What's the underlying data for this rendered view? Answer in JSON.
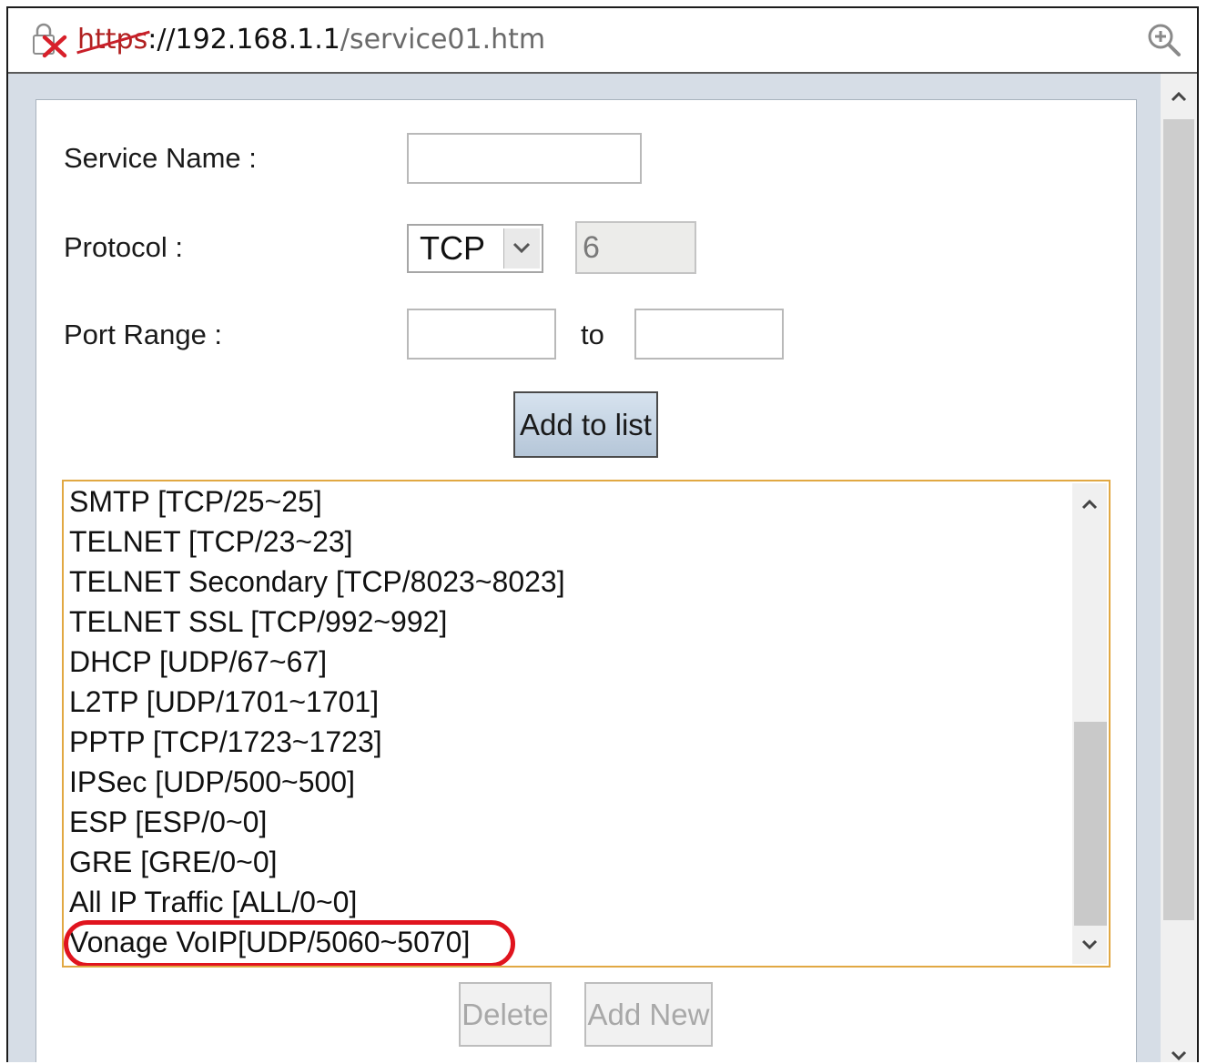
{
  "addressbar": {
    "url_scheme": "https",
    "url_host": "://192.168.1.1",
    "url_path": "/service01.htm",
    "security_icon": "broken-lock-icon",
    "zoom_icon": "zoom-in-icon"
  },
  "form": {
    "service_name_label": "Service Name :",
    "service_name_value": "",
    "protocol_label": "Protocol :",
    "protocol_selected": "TCP",
    "protocol_number": "6",
    "port_range_label": "Port Range :",
    "port_from_value": "",
    "port_to_label": "to",
    "port_to_value": "",
    "add_button_label": "Add to list"
  },
  "services": [
    "SMTP [TCP/25~25]",
    "TELNET [TCP/23~23]",
    "TELNET Secondary [TCP/8023~8023]",
    "TELNET SSL [TCP/992~992]",
    "DHCP [UDP/67~67]",
    "L2TP [UDP/1701~1701]",
    "PPTP [TCP/1723~1723]",
    "IPSec [UDP/500~500]",
    "ESP [ESP/0~0]",
    "GRE [GRE/0~0]",
    "All IP Traffic [ALL/0~0]",
    "Vonage VoIP[UDP/5060~5070]"
  ],
  "highlighted_service": "Vonage VoIP[UDP/5060~5070]",
  "colors": {
    "highlight": "#e0141e",
    "listbox_border": "#e1a843",
    "button_fill": "#c6d5e4"
  },
  "actions": {
    "delete_label": "Delete",
    "add_new_label": "Add New"
  }
}
